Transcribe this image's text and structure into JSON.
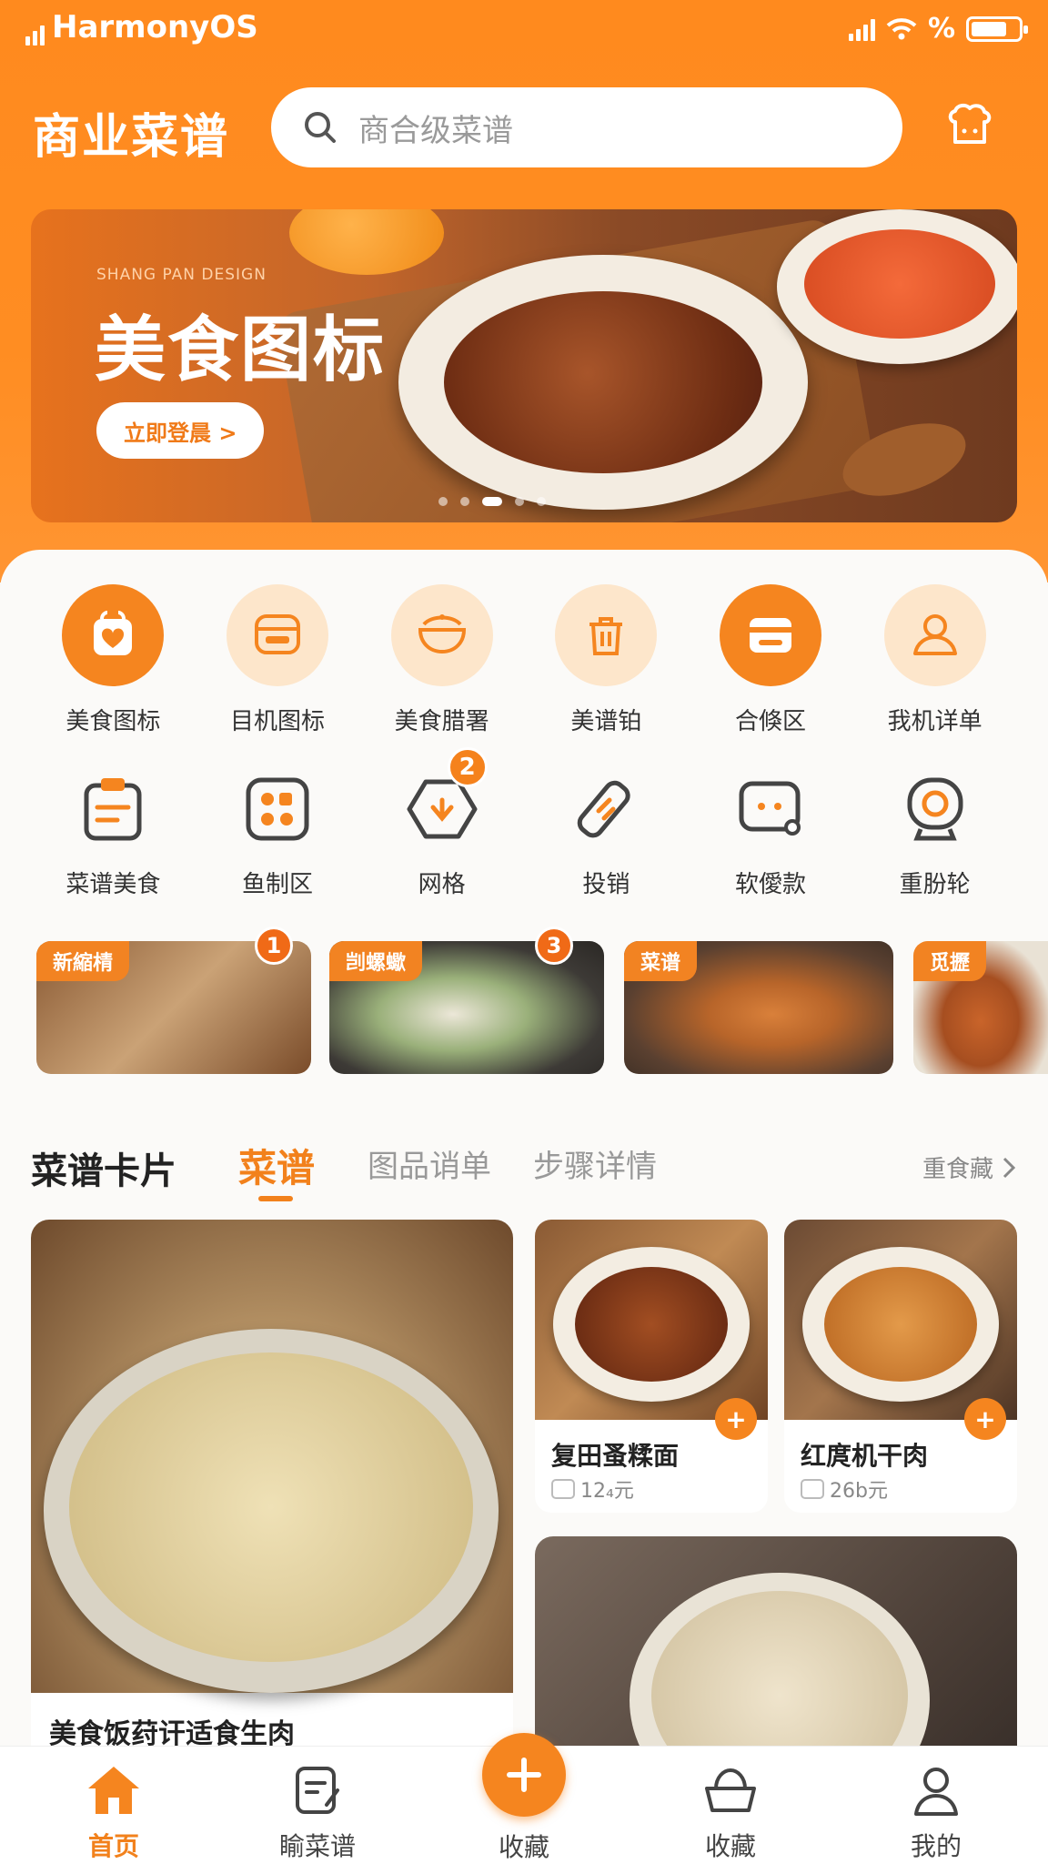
{
  "status": {
    "os": "HarmonyOS",
    "percent": "%"
  },
  "header": {
    "title": "商业菜谱",
    "search_placeholder": "商合级菜谱"
  },
  "banner": {
    "kicker": "SHANG PAN DESIGN",
    "title": "美食图标",
    "cta": "立即登晨 >"
  },
  "grid": [
    {
      "label": "美食图标",
      "icon": "heart-bag-icon"
    },
    {
      "label": "目机图标",
      "icon": "rice-cooker-icon"
    },
    {
      "label": "美食腊署",
      "icon": "pot-icon"
    },
    {
      "label": "美谱铂",
      "icon": "trash-icon"
    },
    {
      "label": "合倏区",
      "icon": "wallet-icon"
    },
    {
      "label": "我机详单",
      "icon": "user-icon"
    },
    {
      "label": "菜谱美食",
      "icon": "clipboard-icon"
    },
    {
      "label": "鱼制区",
      "icon": "apps-icon"
    },
    {
      "label": "网格",
      "icon": "hexagon-icon",
      "badge": "2"
    },
    {
      "label": "投销",
      "icon": "tag-icon"
    },
    {
      "label": "软僾款",
      "icon": "chat-icon"
    },
    {
      "label": "重朌轮",
      "icon": "camera-icon"
    }
  ],
  "promos": [
    {
      "tag": "新縮棈",
      "badge": "1"
    },
    {
      "tag": "剀螺蠍",
      "badge": "3"
    },
    {
      "tag": "菜谱"
    },
    {
      "tag": "觅攊"
    }
  ],
  "section": {
    "title": "菜谱卡片",
    "tabs": [
      "菜谱",
      "图品诮单",
      "步骤详情"
    ],
    "more": "重食藏"
  },
  "cards": {
    "big": {
      "name": "美食饭荮讦适食生肉"
    },
    "small": [
      {
        "name": "复田蚤糅面",
        "price": "12₄元"
      },
      {
        "name": "红庹机干肉",
        "price": "26b元"
      }
    ]
  },
  "nav": {
    "items": [
      "首页",
      "睮菜谱",
      "收藏",
      "收藏",
      "我的"
    ]
  },
  "colors": {
    "accent": "#f5851f"
  }
}
